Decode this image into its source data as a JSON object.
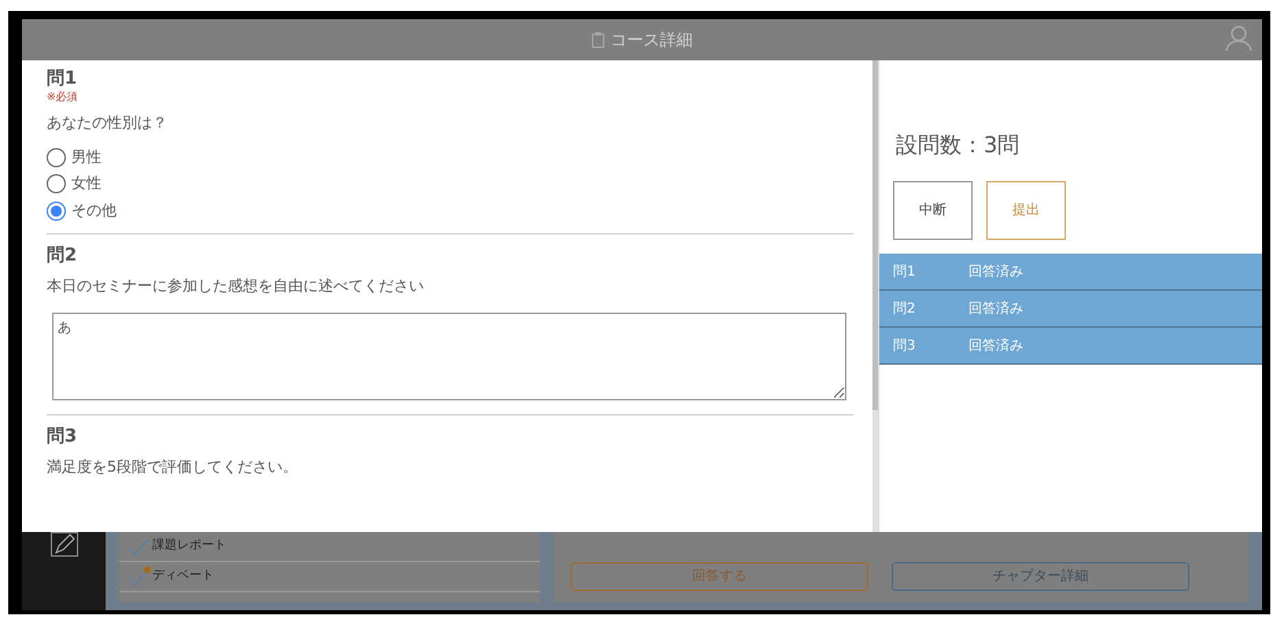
{
  "header": {
    "title": "コース詳細"
  },
  "questions": [
    {
      "label": "問1",
      "required": "※必須",
      "text": "あなたの性別は？",
      "kind": "radio",
      "options": [
        {
          "label": "男性",
          "selected": false
        },
        {
          "label": "女性",
          "selected": false
        },
        {
          "label": "その他",
          "selected": true
        }
      ]
    },
    {
      "label": "問2",
      "text": "本日のセミナーに参加した感想を自由に述べてください",
      "kind": "textarea",
      "value": "あ"
    },
    {
      "label": "問3",
      "text": "満足度を5段階で評価してください。"
    }
  ],
  "summary": {
    "count": "設問数：3問",
    "buttons": [
      {
        "label": "中断",
        "kind": "neutral"
      },
      {
        "label": "提出",
        "kind": "primary"
      }
    ],
    "rows": [
      {
        "number": "問1",
        "status": "回答済み"
      },
      {
        "number": "問2",
        "status": "回答済み"
      },
      {
        "number": "問3",
        "status": "回答済み"
      }
    ]
  },
  "background": {
    "items": [
      {
        "label": "課題レポート",
        "dot": false
      },
      {
        "label": "ディベート",
        "dot": true
      }
    ],
    "buttons": [
      {
        "label": "回答する",
        "kind": "primary"
      },
      {
        "label": "チャプター詳細",
        "kind": "secondary"
      }
    ]
  }
}
